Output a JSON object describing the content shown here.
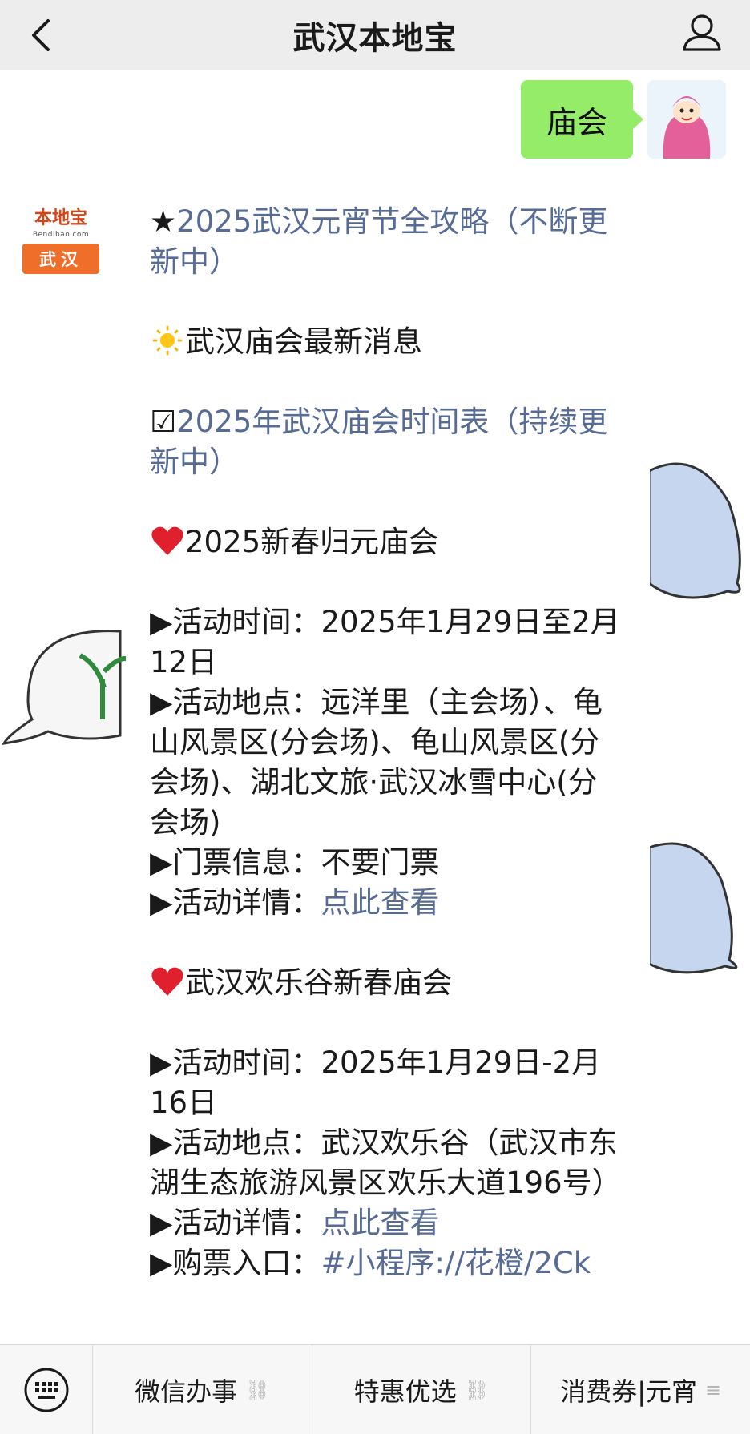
{
  "header": {
    "title": "武汉本地宝"
  },
  "user_message": {
    "text": "庙会"
  },
  "bot_avatar": {
    "logo_top": "本地宝",
    "logo_domain": "Bendibao.com",
    "logo_city": "武汉"
  },
  "reply": {
    "line1_star": "★",
    "line1_link": "2025武汉元宵节全攻略（不断更新中）",
    "line2_text": "武汉庙会最新消息",
    "line3_check": "☑",
    "line3_link": "2025年武汉庙会时间表（持续更新中）",
    "event1": {
      "title": "2025新春归元庙会",
      "time": "▶活动时间：2025年1月29日至2月12日",
      "place": "▶活动地点：远洋里（主会场）、龟山风景区(分会场)、龟山风景区(分会场)、湖北文旅·武汉冰雪中心(分会场)",
      "ticket": "▶门票信息：不要门票",
      "detail_label": "▶活动详情：",
      "detail_link": "点此查看"
    },
    "event2": {
      "title": "武汉欢乐谷新春庙会",
      "time": "▶活动时间：2025年1月29日-2月16日",
      "place": "▶活动地点：武汉欢乐谷（武汉市东湖生态旅游风景区欢乐大道196号）",
      "detail_label": "▶活动详情：",
      "detail_link": "点此查看",
      "buy_label": "▶购票入口：",
      "buy_link": "#小程序://花橙/2Ck"
    }
  },
  "menu": {
    "items": [
      {
        "label": "微信办事",
        "icon": "link-icon"
      },
      {
        "label": "特惠优选",
        "icon": "link-icon"
      },
      {
        "label": "消费券|元宵",
        "icon": "list-icon"
      }
    ]
  },
  "colors": {
    "bubble_green": "#95ec69",
    "link_blue": "#566b95",
    "nav_bg": "#ededed"
  }
}
